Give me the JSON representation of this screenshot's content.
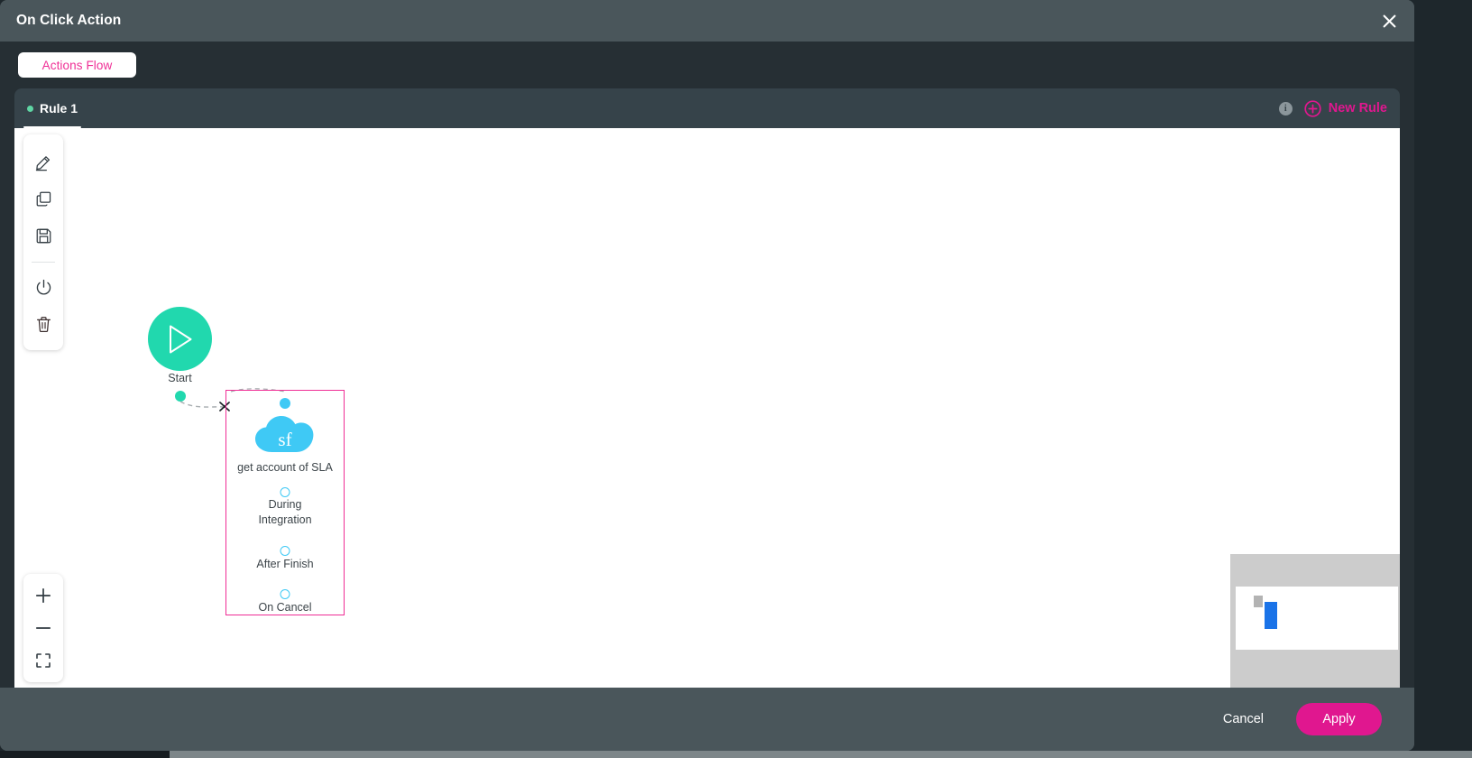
{
  "window": {
    "title": "On Click Action",
    "close_icon": "close-icon"
  },
  "toolbar_tabs": {
    "actions_flow_label": "Actions Flow"
  },
  "rule_bar": {
    "active_rule_label": "Rule 1",
    "info_icon_char": "i",
    "new_rule_label": "New Rule",
    "new_rule_icon": "plus-circle-icon"
  },
  "left_toolbar": {
    "items": [
      {
        "name": "edit-tool",
        "icon": "pencil-icon"
      },
      {
        "name": "copy-tool",
        "icon": "copy-icon"
      },
      {
        "name": "save-tool",
        "icon": "floppy-disk-icon"
      },
      {
        "name": "power-tool",
        "icon": "power-icon"
      },
      {
        "name": "delete-tool",
        "icon": "trash-icon"
      }
    ]
  },
  "canvas": {
    "start_node": {
      "label": "Start",
      "icon": "play-triangle-icon",
      "color": "#21d8ae"
    },
    "salesforce_node": {
      "badge_text": "sf",
      "icon": "salesforce-cloud-icon",
      "title": "get account of SLA",
      "selected": true,
      "selection_color": "#ef2e95",
      "cloud_color": "#3fc9f5",
      "ports": [
        {
          "label": "During\nIntegration",
          "line1": "During",
          "line2": "Integration"
        },
        {
          "label": "After Finish",
          "line1": "After Finish",
          "line2": ""
        },
        {
          "label": "On Cancel",
          "line1": "On Cancel",
          "line2": ""
        }
      ]
    },
    "connection": {
      "style": "dashed",
      "end_marker": "x-marker"
    }
  },
  "zoom_controls": {
    "zoom_in_icon": "plus-icon",
    "zoom_out_icon": "minus-icon",
    "fit_screen_icon": "fit-screen-icon"
  },
  "minimap": {
    "name": "canvas-minimap"
  },
  "footer": {
    "cancel_label": "Cancel",
    "apply_label": "Apply",
    "apply_color": "#e0178f"
  }
}
